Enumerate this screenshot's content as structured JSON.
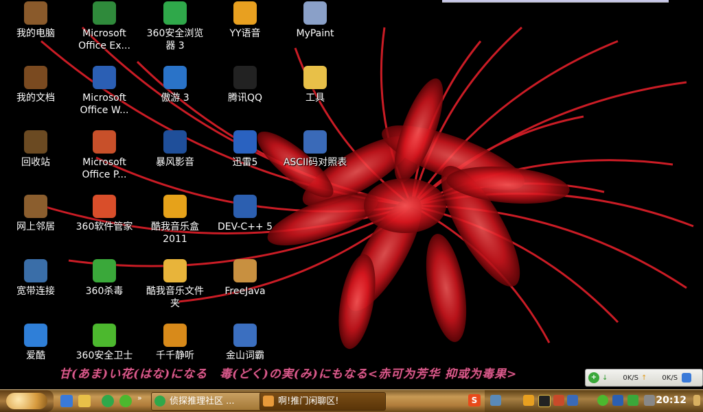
{
  "desktop": {
    "icons": [
      {
        "label": "我的电脑",
        "icon": "my-computer-icon",
        "color": "#8a5a2b"
      },
      {
        "label": "我的文档",
        "icon": "my-documents-icon",
        "color": "#7a4a20"
      },
      {
        "label": "回收站",
        "icon": "recycle-bin-icon",
        "color": "#6b4a22"
      },
      {
        "label": "网上邻居",
        "icon": "network-places-icon",
        "color": "#8b5e2e"
      },
      {
        "label": "宽带连接",
        "icon": "broadband-connection-icon",
        "color": "#3a6ea8"
      },
      {
        "label": "爱酷",
        "icon": "aiku-play-icon",
        "color": "#2f7fd8"
      },
      {
        "label": "Microsoft\nOffice Ex...",
        "icon": "excel-icon",
        "color": "#2f8a3b"
      },
      {
        "label": "Microsoft\nOffice W...",
        "icon": "word-icon",
        "color": "#2b5fb4"
      },
      {
        "label": "Microsoft\nOffice P...",
        "icon": "powerpoint-icon",
        "color": "#c8502a"
      },
      {
        "label": "360软件管家",
        "icon": "360-software-manager-icon",
        "color": "#d94e2a"
      },
      {
        "label": "360杀毒",
        "icon": "360-antivirus-icon",
        "color": "#3aa83a"
      },
      {
        "label": "360安全卫士",
        "icon": "360-safe-guard-icon",
        "color": "#4cb82e"
      },
      {
        "label": "360安全浏览\n器 3",
        "icon": "360-browser-icon",
        "color": "#2fa84a"
      },
      {
        "label": "傲游 3",
        "icon": "maxthon-icon",
        "color": "#2a73c8"
      },
      {
        "label": "暴风影音",
        "icon": "storm-player-icon",
        "color": "#1f4f9a"
      },
      {
        "label": "酷我音乐盒\n2011",
        "icon": "kuwo-music-icon",
        "color": "#e6a21a"
      },
      {
        "label": "酷我音乐文件\n夹",
        "icon": "kuwo-folder-icon",
        "color": "#e8b43a"
      },
      {
        "label": "千千静听",
        "icon": "ttplayer-icon",
        "color": "#d88a1a"
      },
      {
        "label": "YY语音",
        "icon": "yy-voice-icon",
        "color": "#e8a020"
      },
      {
        "label": "腾讯QQ",
        "icon": "qq-penguin-icon",
        "color": "#222222"
      },
      {
        "label": "迅雷5",
        "icon": "thunder-icon",
        "color": "#2a62c0"
      },
      {
        "label": "DEV-C++ 5",
        "icon": "dev-cpp-icon",
        "color": "#2c5fb0"
      },
      {
        "label": "FreeJava",
        "icon": "freejava-icon",
        "color": "#c89040"
      },
      {
        "label": "金山词霸",
        "icon": "kingsoft-dictionary-icon",
        "color": "#3b6fc0"
      },
      {
        "label": "MyPaint",
        "icon": "mypaint-icon",
        "color": "#8aa0c8"
      },
      {
        "label": "工具",
        "icon": "folder-icon",
        "color": "#e8c048"
      },
      {
        "label": "ASCII码对照表",
        "icon": "word-document-icon",
        "color": "#3a6ab8"
      }
    ]
  },
  "banner": {
    "text": "甘(あま)い花(はな)になる　毒(どく)の実(み)にもなる<赤可为芳华 抑或为毒果>"
  },
  "speed_widget": {
    "download": "0K/S",
    "upload": "0K/S"
  },
  "taskbar": {
    "start_icon": "start-orb-icon",
    "quick_launch": [
      "ie-icon",
      "folder-icon",
      "360-browser-icon",
      "360-safe-guard-icon"
    ],
    "quick_launch_more": "»",
    "tasks": [
      {
        "label": "侦探推理社区 ...",
        "icon": "360-browser-icon",
        "active": false
      },
      {
        "label": "啊!推门闲聊区!",
        "icon": "qq-group-icon",
        "active": true
      }
    ],
    "tray_icons": [
      "sogou-input-icon",
      "network-icon",
      "yy-voice-icon",
      "qq-penguin-icon",
      "volume-icon",
      "network-adapter-icon",
      "360-safe-guard-icon",
      "dev-icon",
      "shield-icon",
      "usb-icon"
    ],
    "clock": "20:12"
  },
  "colors": {
    "taskbar": "#b07c3a",
    "banner_text": "#d85a8e",
    "flower": "#d8161e"
  }
}
